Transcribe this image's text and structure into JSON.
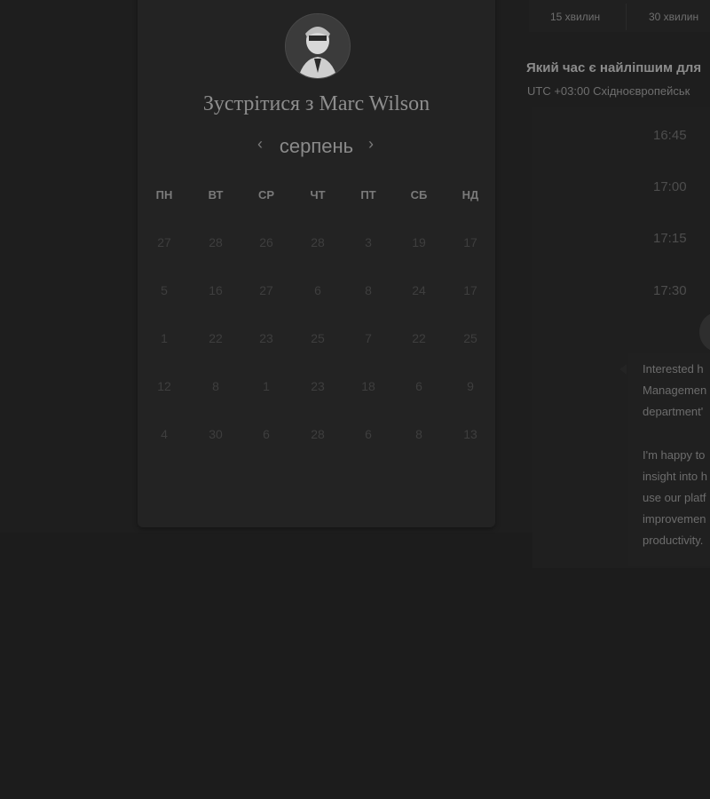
{
  "header": {
    "title_prefix": "Зустрітися з",
    "host_name": "Marc Wilson"
  },
  "calendar": {
    "month": "серпень",
    "prev_icon": "chevron-left-icon",
    "next_icon": "chevron-right-icon",
    "weekdays": [
      "ПН",
      "ВТ",
      "СР",
      "ЧТ",
      "ПТ",
      "СБ",
      "НД"
    ],
    "weeks": [
      [
        "27",
        "28",
        "26",
        "28",
        "3",
        "19",
        "17"
      ],
      [
        "5",
        "16",
        "27",
        "6",
        "8",
        "24",
        "17"
      ],
      [
        "1",
        "22",
        "23",
        "25",
        "7",
        "22",
        "25"
      ],
      [
        "12",
        "8",
        "1",
        "23",
        "18",
        "6",
        "9"
      ],
      [
        "4",
        "30",
        "6",
        "28",
        "6",
        "8",
        "13"
      ]
    ]
  },
  "duration_tabs": [
    "15 хвилин",
    "30 хвилин"
  ],
  "times": {
    "question": "Який час є найліпшим для",
    "timezone": "UTC +03:00 Східноєвропейськ",
    "slots": [
      "16:45",
      "17:00",
      "17:15",
      "17:30"
    ]
  },
  "description": {
    "paragraph1": [
      "Interested h",
      "Managemen",
      "department'"
    ],
    "paragraph2": [
      "I'm happy to",
      "insight into h",
      "use our platf",
      "improvemen",
      "productivity."
    ]
  }
}
